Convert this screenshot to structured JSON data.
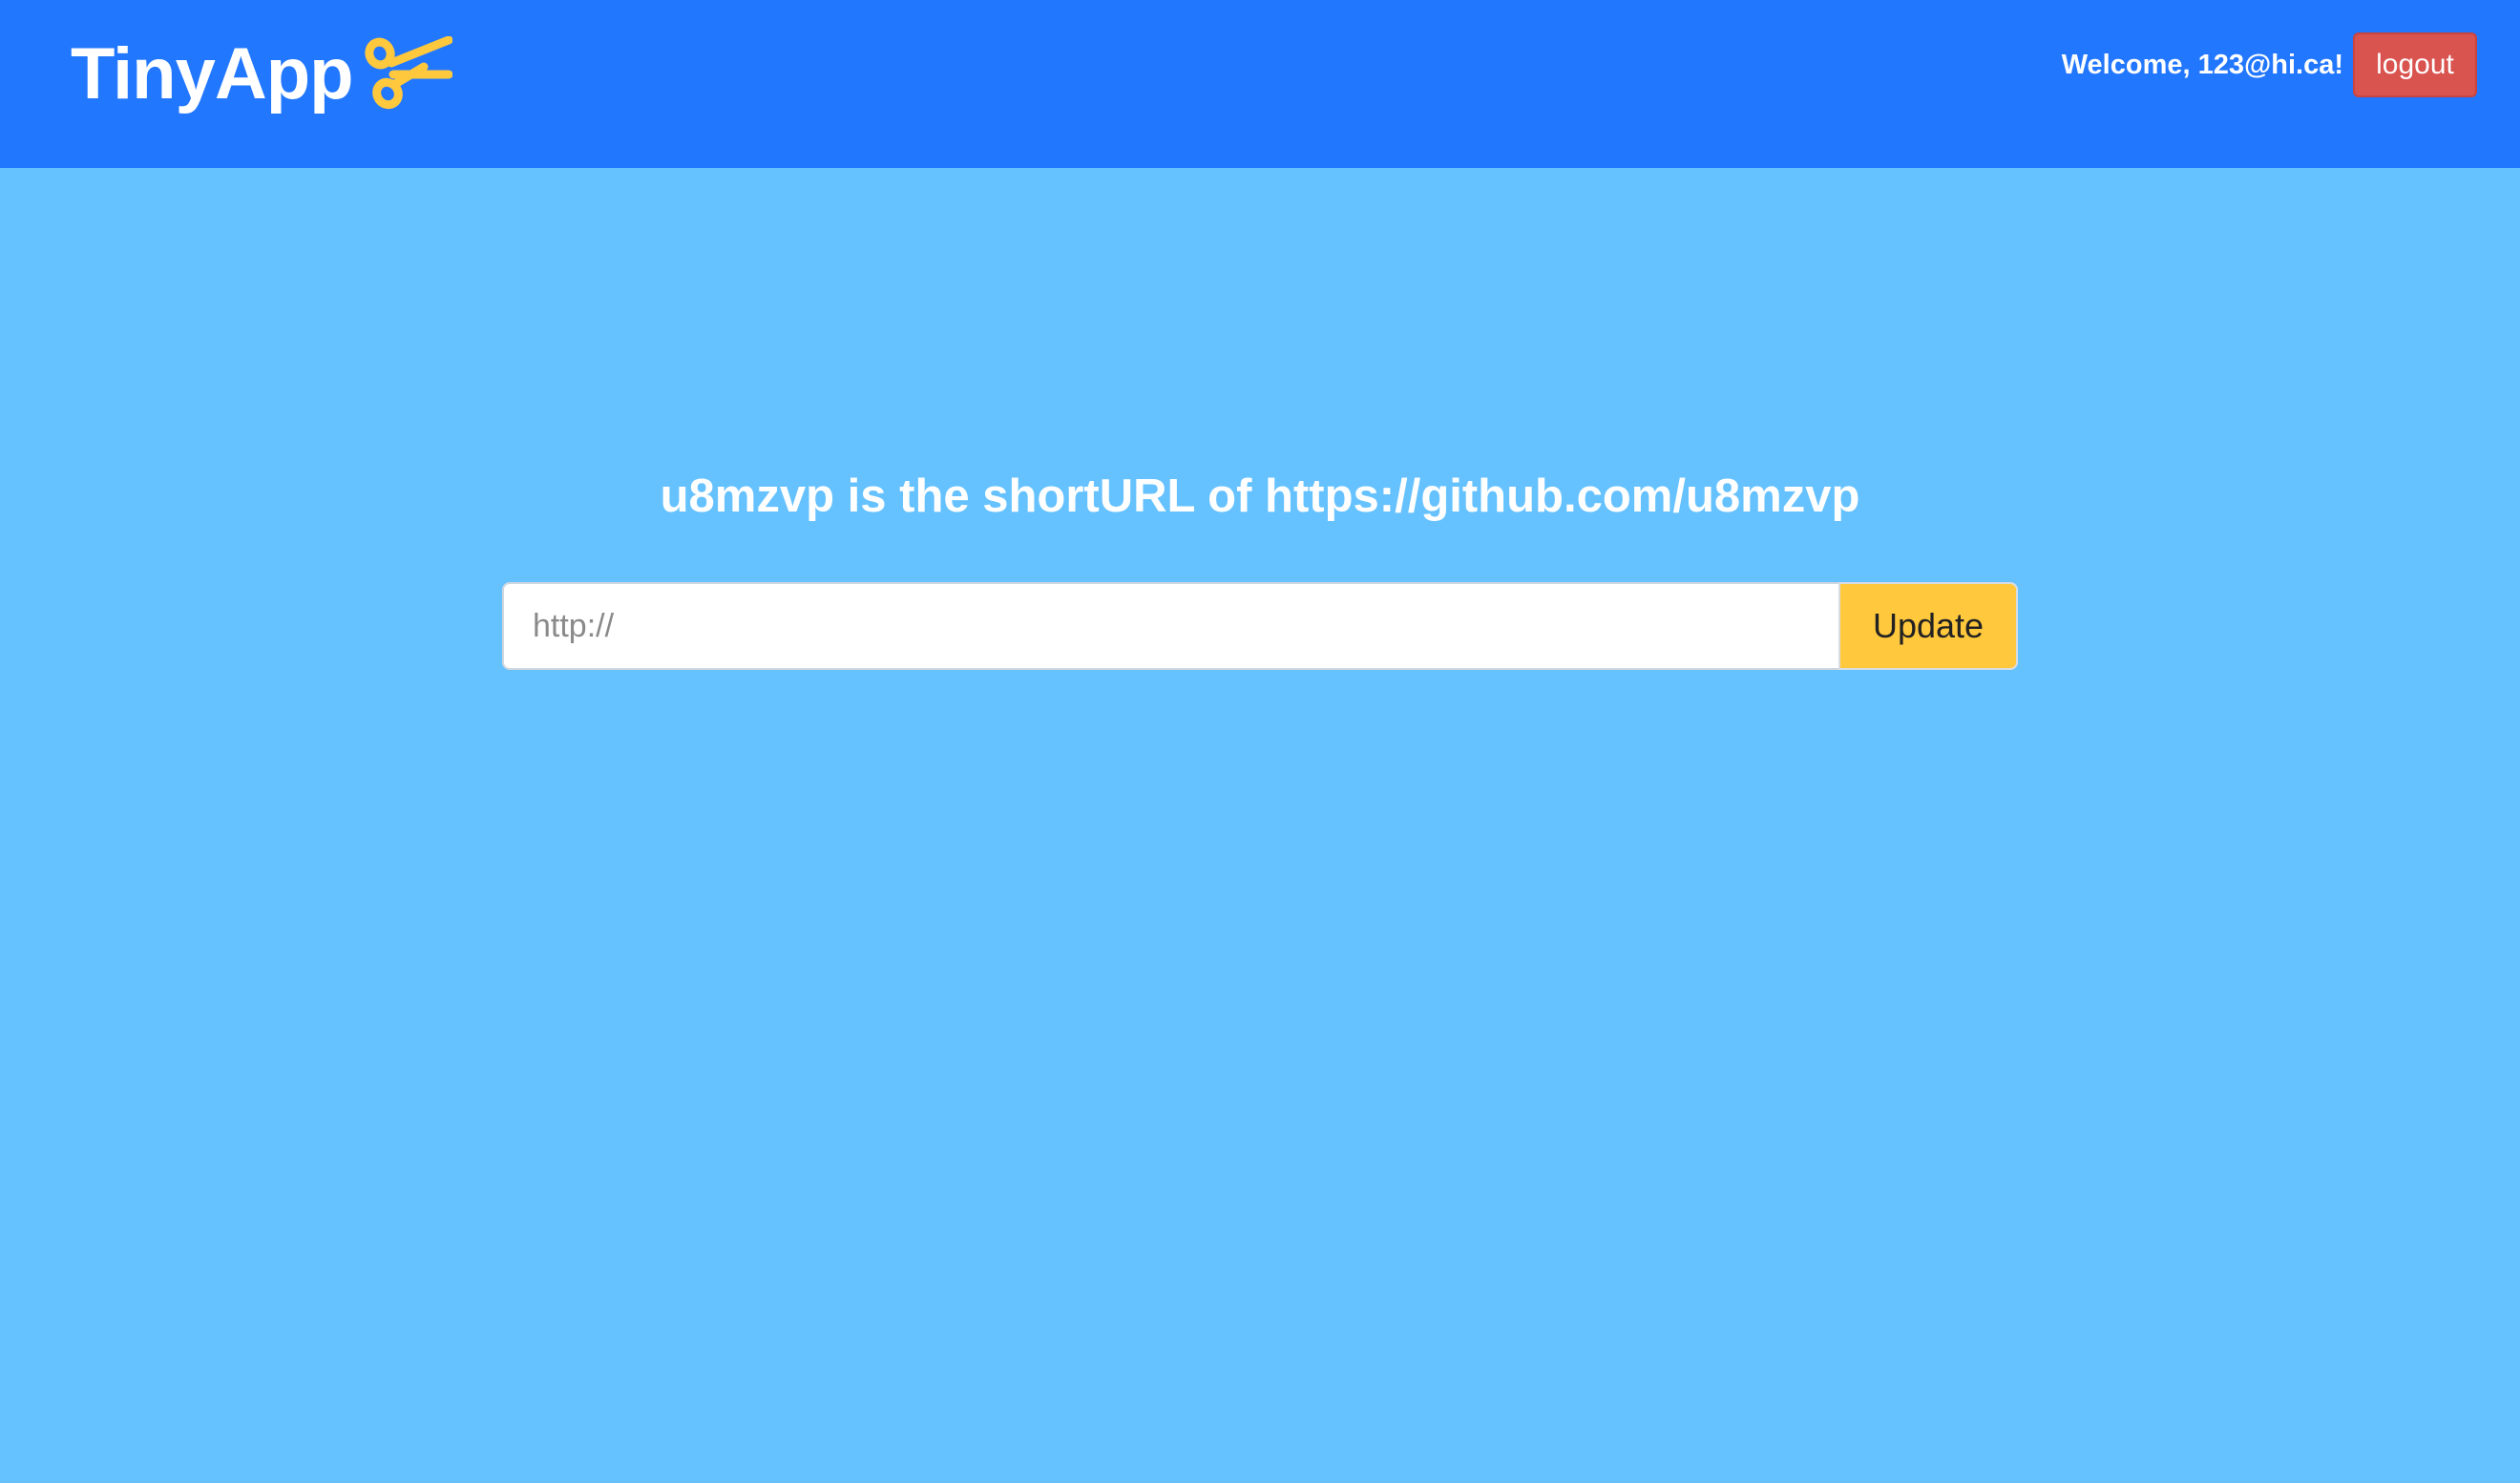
{
  "header": {
    "brand": "TinyApp",
    "brand_icon": "scissors-icon",
    "welcome_text": "Welcome, 123@hi.ca!",
    "logout_label": "logout"
  },
  "main": {
    "heading": "u8mzvp is the shortURL of https://github.com/u8mzvp",
    "url_input": {
      "placeholder": "http://",
      "value": ""
    },
    "update_label": "Update"
  },
  "colors": {
    "navbar": "#2277ff",
    "background": "#66c2ff",
    "accent": "#ffc83d",
    "danger": "#d9534f"
  }
}
